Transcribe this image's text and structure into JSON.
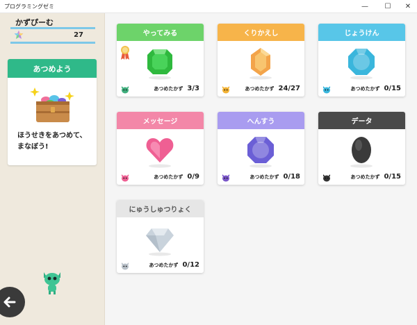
{
  "window": {
    "title": "プログラミングゼミ",
    "min": "—",
    "max": "☐",
    "close": "✕"
  },
  "sidebar": {
    "username": "かずぴーむ",
    "score": "27",
    "collect_card": {
      "title": "あつめよう",
      "text": "ほうせきをあつめて、\nまなぼう!"
    }
  },
  "cards": [
    {
      "title": "やってみる",
      "head_color": "#6dd36a",
      "gem_color": "#2fb93e",
      "gem_shape": "octagon",
      "has_medal": true,
      "char_color": "#3fae7d",
      "label": "あつめたかず",
      "count": "3/3"
    },
    {
      "title": "くりかえし",
      "head_color": "#f7b44a",
      "gem_color": "#f3a44a",
      "gem_shape": "hexagon",
      "has_medal": false,
      "char_color": "#f2b234",
      "label": "あつめたかず",
      "count": "24/27"
    },
    {
      "title": "じょうけん",
      "head_color": "#58c6e8",
      "gem_color": "#3ab6dc",
      "gem_shape": "round",
      "has_medal": false,
      "char_color": "#3ab6dc",
      "label": "あつめたかず",
      "count": "0/15"
    },
    {
      "title": "メッセージ",
      "head_color": "#f387a8",
      "gem_color": "#ef5f93",
      "gem_shape": "heart",
      "has_medal": false,
      "char_color": "#ef5f93",
      "label": "あつめたかず",
      "count": "0/9"
    },
    {
      "title": "へんすう",
      "head_color": "#a99cf0",
      "gem_color": "#6b5fd6",
      "gem_shape": "round",
      "has_medal": false,
      "char_color": "#7a56c9",
      "label": "あつめたかず",
      "count": "0/18"
    },
    {
      "title": "データ",
      "head_color": "#4a4a4a",
      "gem_color": "#3a3a3a",
      "gem_shape": "oval",
      "has_medal": false,
      "char_color": "#333333",
      "label": "あつめたかず",
      "count": "0/15"
    },
    {
      "title": "にゅうしゅつりょく",
      "head_color": "#e6e6e6",
      "gem_color": "#c9d3dc",
      "gem_shape": "diamond",
      "has_medal": false,
      "char_color": "#b8c0c8",
      "label": "あつめたかず",
      "count": "0/12"
    }
  ]
}
